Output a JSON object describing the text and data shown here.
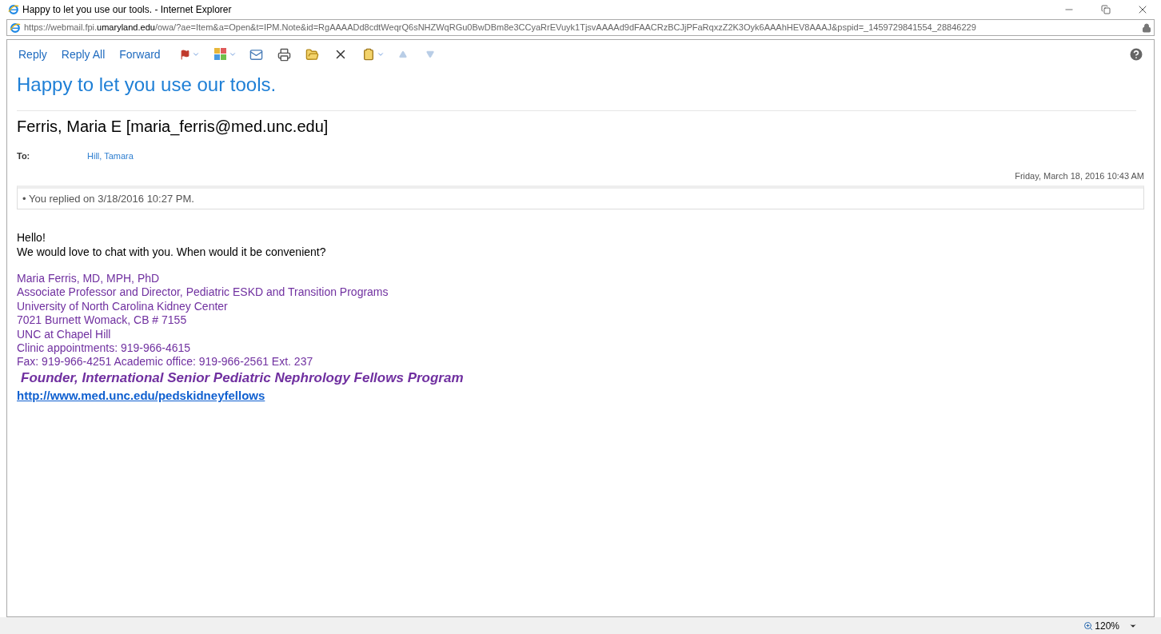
{
  "window": {
    "title": "Happy to let you use our tools. - Internet Explorer"
  },
  "address_bar": {
    "url": "https://webmail.fpi.**umaryland.edu**/owa/?ae=Item&a=Open&t=IPM.Note&id=RgAAAADd8cdtWeqrQ6sNHZWqRGu0BwDBm8e3CCyaRrEVuyk1TjsvAAAAd9dFAACRzBCJjPFaRqxzZ2K3Oyk6AAAhHEV8AAAJ&pspid=_1459729841554_28846229"
  },
  "toolbar": {
    "actions": [
      "Reply",
      "Reply All",
      "Forward"
    ]
  },
  "message": {
    "subject": "Happy to let you use our tools.",
    "sender": "Ferris, Maria E [maria_ferris@med.unc.edu]",
    "to_label": "To:",
    "to": "Hill, Tamara",
    "date": "Friday, March 18, 2016 10:43 AM",
    "info_bar": "• You replied on 3/18/2016 10:27 PM.",
    "body": [
      "Hello!",
      "We would love to chat with you. When would it be convenient?"
    ],
    "signature": [
      "Maria Ferris, MD, MPH, PhD",
      "Associate Professor and Director, Pediatric ESKD and Transition Programs",
      "University of North Carolina Kidney Center",
      "7021 Burnett Womack, CB # 7155",
      "UNC at Chapel Hill",
      "Clinic appointments: 919-966-4615",
      "Fax: 919-966-4251 Academic office: 919-966-2561  Ext. 237"
    ],
    "founder_line": "Founder, International Senior Pediatric Nephrology Fellows Program",
    "link": "http://www.med.unc.edu/pedskidneyfellows"
  },
  "status_bar": {
    "zoom": "120%"
  }
}
